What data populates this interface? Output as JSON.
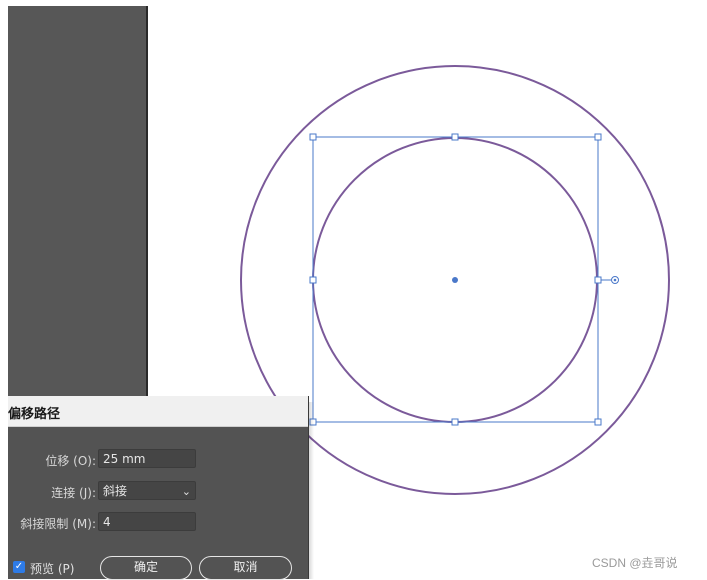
{
  "dialog": {
    "title": "偏移路径",
    "offset_label": "位移 (O):",
    "offset_value": "25 mm",
    "join_label": "连接 (J):",
    "join_value": "斜接",
    "miter_label": "斜接限制 (M):",
    "miter_value": "4",
    "preview_label": "预览 (P)",
    "preview_checked": true,
    "ok_label": "确定",
    "cancel_label": "取消"
  },
  "canvas": {
    "stroke_color": "#7b5a9a",
    "selection_color": "#4a78c9"
  },
  "watermark": "CSDN @垚哥说"
}
